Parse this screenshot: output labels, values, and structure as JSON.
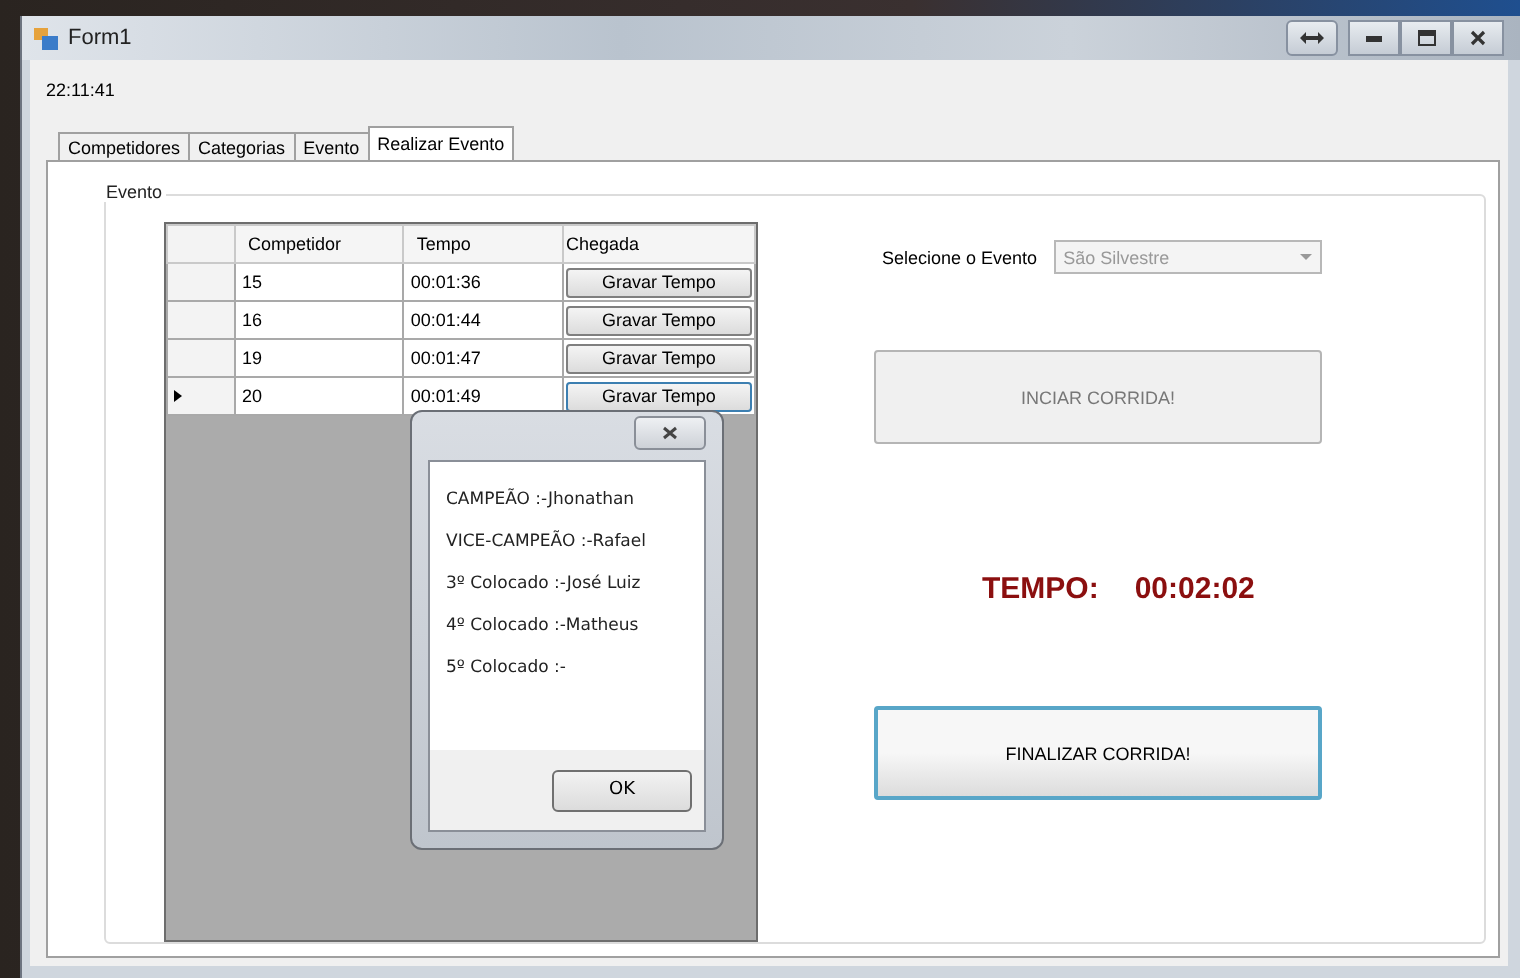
{
  "window": {
    "title": "Form1"
  },
  "clock": "22:11:41",
  "tabs": [
    {
      "label": "Competidores",
      "selected": false
    },
    {
      "label": "Categorias",
      "selected": false
    },
    {
      "label": "Evento",
      "selected": false
    },
    {
      "label": "Realizar Evento",
      "selected": true
    }
  ],
  "group": {
    "title": "Evento"
  },
  "grid": {
    "columns": [
      "Competidor",
      "Tempo",
      "Chegada"
    ],
    "rows": [
      {
        "competitor": "15",
        "time": "00:01:36",
        "button": "Gravar Tempo",
        "selected": false
      },
      {
        "competitor": "16",
        "time": "00:01:44",
        "button": "Gravar Tempo",
        "selected": false
      },
      {
        "competitor": "19",
        "time": "00:01:47",
        "button": "Gravar Tempo",
        "selected": false
      },
      {
        "competitor": "20",
        "time": "00:01:49",
        "button": "Gravar Tempo",
        "selected": true
      }
    ]
  },
  "dialog": {
    "lines": [
      "CAMPEÃO :-Jhonathan",
      "VICE-CAMPEÃO :-Rafael",
      "3º Colocado :-José Luiz",
      "4º Colocado :-Matheus",
      "5º Colocado :-"
    ],
    "button": "OK"
  },
  "event_select": {
    "label": "Selecione o Evento",
    "value": "São Silvestre",
    "disabled": true
  },
  "start_button": {
    "label": "INCIAR CORRIDA!",
    "disabled": true
  },
  "timer": {
    "label": "TEMPO:",
    "value": "00:02:02"
  },
  "finish_button": {
    "label": "FINALIZAR CORRIDA!",
    "focused": true
  }
}
